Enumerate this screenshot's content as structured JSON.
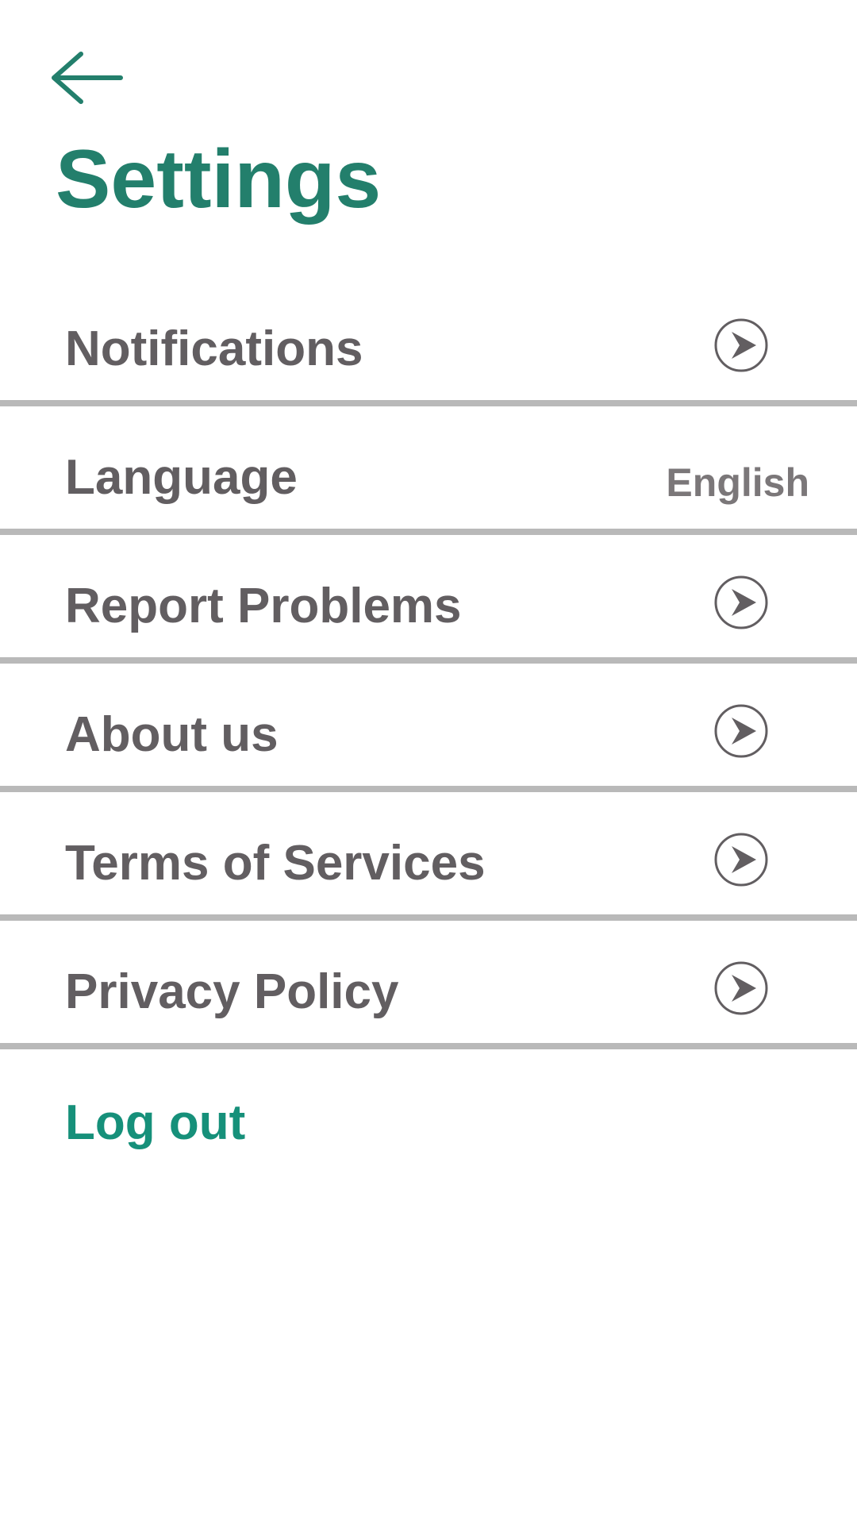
{
  "header": {
    "back_icon": "arrow-left-icon",
    "title": "Settings"
  },
  "settings": {
    "items": [
      {
        "label": "Notifications",
        "trailing": "chevron-right-circle-icon"
      },
      {
        "label": "Language",
        "value": "English"
      },
      {
        "label": "Report Problems",
        "trailing": "chevron-right-circle-icon"
      },
      {
        "label": "About us",
        "trailing": "chevron-right-circle-icon"
      },
      {
        "label": "Terms of Services",
        "trailing": "chevron-right-circle-icon"
      },
      {
        "label": "Privacy Policy",
        "trailing": "chevron-right-circle-icon"
      }
    ]
  },
  "logout": {
    "label": "Log out"
  },
  "colors": {
    "accent": "#237f6c",
    "logout": "#16907a",
    "text": "#625e61",
    "secondary_text": "#7b7779",
    "divider": "#b9b9b9",
    "background": "#ffffff"
  }
}
